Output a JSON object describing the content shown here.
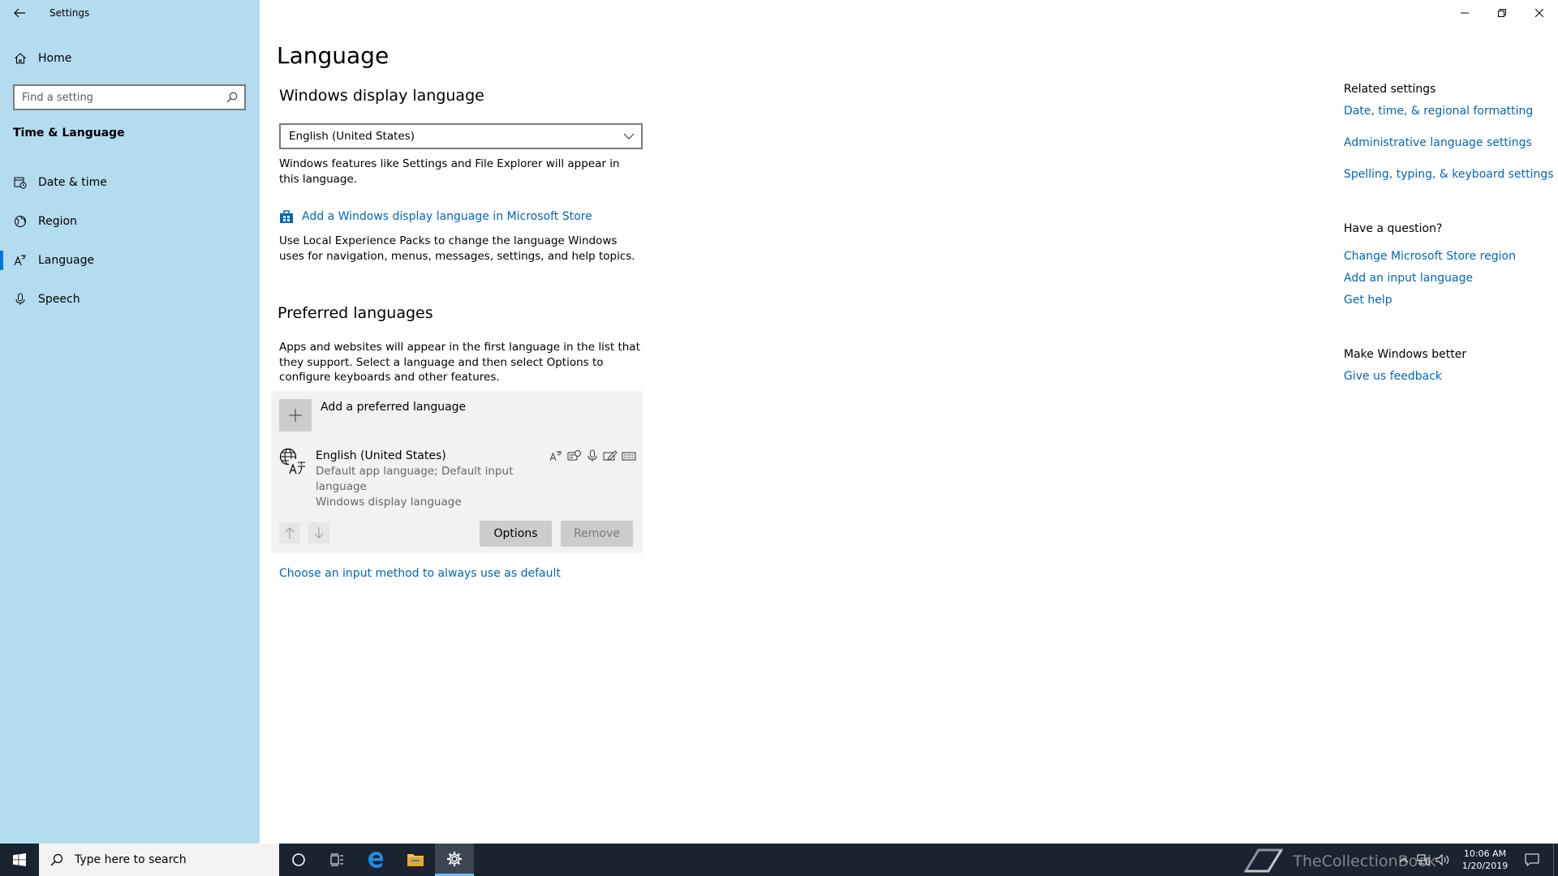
{
  "window": {
    "title": "Settings",
    "controls": {
      "minimize": "minimize",
      "restore": "restore",
      "close": "close"
    }
  },
  "sidebar": {
    "home_label": "Home",
    "search_placeholder": "Find a setting",
    "section": "Time & Language",
    "items": [
      {
        "label": "Date & time",
        "icon": "calendar-clock-icon"
      },
      {
        "label": "Region",
        "icon": "globe-region-icon"
      },
      {
        "label": "Language",
        "icon": "language-icon",
        "active": true
      },
      {
        "label": "Speech",
        "icon": "microphone-icon"
      }
    ],
    "accent": "#0078d7",
    "background": "#b4dcef"
  },
  "main": {
    "title": "Language",
    "display_language": {
      "heading": "Windows display language",
      "selected": "English (United States)",
      "description": "Windows features like Settings and File Explorer will appear in this language.",
      "store_link": "Add a Windows display language in Microsoft Store",
      "store_description": "Use Local Experience Packs to change the language Windows uses for navigation, menus, messages, settings, and help topics."
    },
    "preferred": {
      "heading": "Preferred languages",
      "description": "Apps and websites will appear in the first language in the list that they support. Select a language and then select Options to configure keyboards and other features.",
      "add_label": "Add a preferred language",
      "languages": [
        {
          "name": "English (United States)",
          "line1": "Default app language; Default input language",
          "line2": "Windows display language"
        }
      ],
      "options_label": "Options",
      "remove_label": "Remove"
    },
    "input_method_link": "Choose an input method to always use as default"
  },
  "related": {
    "heading1": "Related settings",
    "links1": [
      "Date, time, & regional formatting",
      "Administrative language settings",
      "Spelling, typing, & keyboard settings"
    ],
    "heading2": "Have a question?",
    "links2": [
      "Change Microsoft Store region",
      "Add an input language",
      "Get help"
    ],
    "heading3": "Make Windows better",
    "links3": [
      "Give us feedback"
    ],
    "link_color": "#0067b8"
  },
  "taskbar": {
    "search_placeholder": "Type here to search",
    "time": "10:06 AM",
    "date": "1/20/2019",
    "watermark": "TheCollectionBook",
    "background": "#1a2330"
  }
}
